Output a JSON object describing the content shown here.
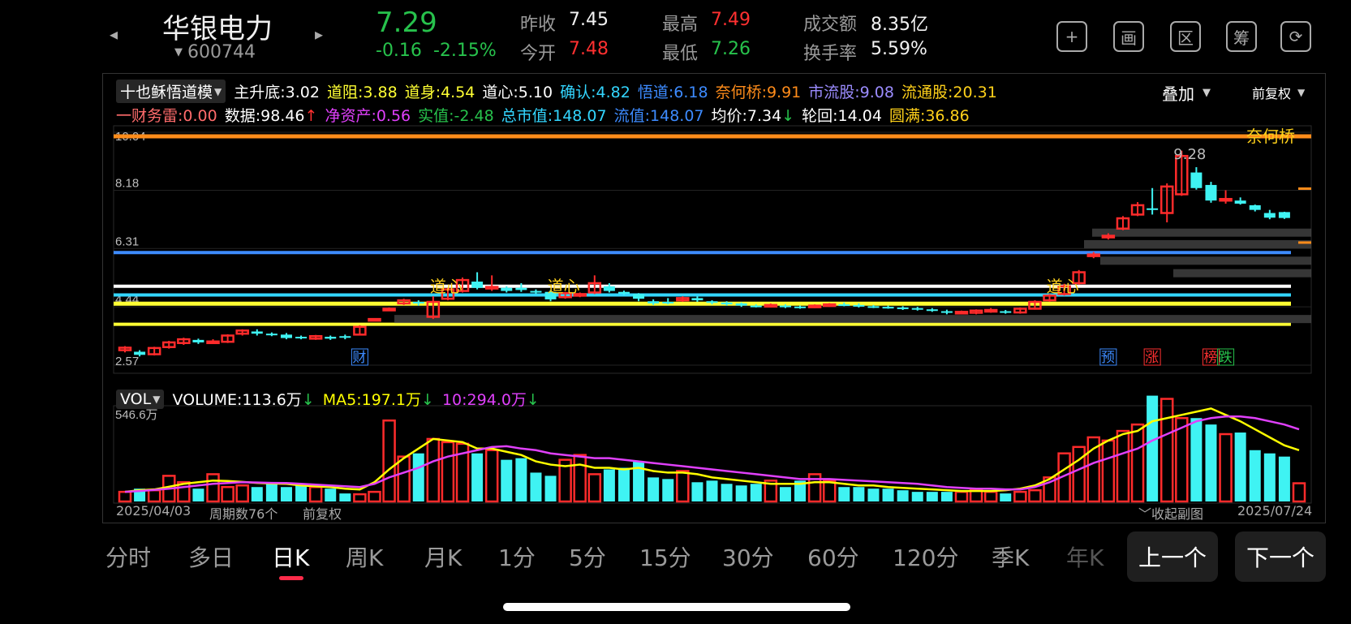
{
  "header": {
    "stock_name": "华银电力",
    "stock_code": "600744",
    "price": "7.29",
    "change": "-0.16",
    "change_pct": "-2.15%",
    "stats": [
      {
        "label": "昨收",
        "value": "7.45",
        "color": "white"
      },
      {
        "label": "今开",
        "value": "7.48",
        "color": "red"
      },
      {
        "label": "最高",
        "value": "7.49",
        "color": "red"
      },
      {
        "label": "最低",
        "value": "7.26",
        "color": "green"
      },
      {
        "label": "成交额",
        "value": "8.35亿",
        "color": "white"
      },
      {
        "label": "换手率",
        "value": "5.59%",
        "color": "white"
      }
    ],
    "icons": [
      "plus-icon",
      "picture-icon",
      "zone-icon",
      "chips-icon",
      "rotate-icon"
    ],
    "icon_glyphs": [
      "+",
      "画",
      "区",
      "筹",
      "⟳"
    ]
  },
  "indicators": {
    "selector": "十也稣悟道模",
    "row1": [
      {
        "text": "主升底:3.02",
        "color": "#ffffff"
      },
      {
        "text": "道阻:3.88",
        "color": "#ffff33"
      },
      {
        "text": "道身:4.54",
        "color": "#ffff33"
      },
      {
        "text": "道心:5.10",
        "color": "#ffffff"
      },
      {
        "text": "确认:4.82",
        "color": "#33d6ff"
      },
      {
        "text": "悟道:6.18",
        "color": "#3d8bff"
      },
      {
        "text": "奈何桥:9.91",
        "color": "#ff8c1a"
      },
      {
        "text": "市流股:9.08",
        "color": "#9b8cff"
      },
      {
        "text": "流通股:20.31",
        "color": "#ffd11a"
      }
    ],
    "row2": [
      {
        "text": "一财务雷:0.00",
        "color": "#ff6b6b"
      },
      {
        "text": "数据:98.46",
        "color": "#ffffff",
        "arrow": "↑",
        "arrow_color": "#ff3030"
      },
      {
        "text": "净资产:0.56",
        "color": "#e040fb"
      },
      {
        "text": "实值:-2.48",
        "color": "#27c24c"
      },
      {
        "text": "总市值:148.07",
        "color": "#33d6ff"
      },
      {
        "text": "流值:148.07",
        "color": "#3d8bff"
      },
      {
        "text": "均价:7.34",
        "color": "#ffffff",
        "arrow": "↓",
        "arrow_color": "#27c24c"
      },
      {
        "text": "轮回:14.04",
        "color": "#ffffff"
      },
      {
        "text": "圆满:36.86",
        "color": "#ffd11a"
      }
    ],
    "overlay_label": "叠加",
    "adjust_label": "前复权"
  },
  "chart_data": [
    {
      "type": "candlestick",
      "y_ticks": [
        "10.04",
        "8.18",
        "6.31",
        "4.44",
        "2.57"
      ],
      "ylim": [
        2.57,
        10.04
      ],
      "candles": [
        [
          3.05,
          3.13,
          2.98,
          3.18
        ],
        [
          3.0,
          2.9,
          2.85,
          3.05
        ],
        [
          2.92,
          3.12,
          2.88,
          3.16
        ],
        [
          3.15,
          3.3,
          3.1,
          3.35
        ],
        [
          3.28,
          3.4,
          3.22,
          3.45
        ],
        [
          3.38,
          3.3,
          3.25,
          3.42
        ],
        [
          3.3,
          3.33,
          3.25,
          3.4
        ],
        [
          3.32,
          3.52,
          3.28,
          3.56
        ],
        [
          3.58,
          3.68,
          3.52,
          3.72
        ],
        [
          3.65,
          3.58,
          3.52,
          3.72
        ],
        [
          3.58,
          3.55,
          3.5,
          3.62
        ],
        [
          3.55,
          3.44,
          3.4,
          3.6
        ],
        [
          3.48,
          3.44,
          3.4,
          3.52
        ],
        [
          3.42,
          3.5,
          3.38,
          3.54
        ],
        [
          3.48,
          3.42,
          3.38,
          3.52
        ],
        [
          3.5,
          3.45,
          3.4,
          3.55
        ],
        [
          3.55,
          3.8,
          3.52,
          3.85
        ],
        [
          4.02,
          4.05,
          3.98,
          4.08
        ],
        [
          4.35,
          4.38,
          4.32,
          4.42
        ],
        [
          4.55,
          4.65,
          4.5,
          4.7
        ],
        [
          4.6,
          4.55,
          4.48,
          4.65
        ],
        [
          4.12,
          4.6,
          4.05,
          4.78
        ],
        [
          4.7,
          5.0,
          4.65,
          5.05
        ],
        [
          4.95,
          5.3,
          4.9,
          5.38
        ],
        [
          5.25,
          5.05,
          5.0,
          5.55
        ],
        [
          5.05,
          5.08,
          4.95,
          5.45
        ],
        [
          5.05,
          4.95,
          4.9,
          5.1
        ],
        [
          5.05,
          4.98,
          4.92,
          5.2
        ],
        [
          4.95,
          4.9,
          4.85,
          5.0
        ],
        [
          4.92,
          4.68,
          4.62,
          4.98
        ],
        [
          4.75,
          4.88,
          4.7,
          4.92
        ],
        [
          4.8,
          4.85,
          4.75,
          4.9
        ],
        [
          4.9,
          5.2,
          4.85,
          5.45
        ],
        [
          5.1,
          4.95,
          4.9,
          5.2
        ],
        [
          4.92,
          4.88,
          4.82,
          4.96
        ],
        [
          4.85,
          4.7,
          4.62,
          4.88
        ],
        [
          4.62,
          4.55,
          4.5,
          4.68
        ],
        [
          4.6,
          4.58,
          4.52,
          4.72
        ],
        [
          4.65,
          4.72,
          4.6,
          4.78
        ],
        [
          4.72,
          4.65,
          4.6,
          4.78
        ],
        [
          4.62,
          4.58,
          4.52,
          4.65
        ],
        [
          4.58,
          4.52,
          4.48,
          4.62
        ],
        [
          4.55,
          4.48,
          4.44,
          4.58
        ],
        [
          4.48,
          4.46,
          4.42,
          4.52
        ],
        [
          4.48,
          4.5,
          4.42,
          4.55
        ],
        [
          4.48,
          4.45,
          4.4,
          4.52
        ],
        [
          4.45,
          4.42,
          4.38,
          4.48
        ],
        [
          4.45,
          4.48,
          4.4,
          4.52
        ],
        [
          4.48,
          4.52,
          4.44,
          4.56
        ],
        [
          4.52,
          4.5,
          4.46,
          4.58
        ],
        [
          4.5,
          4.46,
          4.42,
          4.55
        ],
        [
          4.46,
          4.44,
          4.4,
          4.5
        ],
        [
          4.44,
          4.42,
          4.38,
          4.48
        ],
        [
          4.42,
          4.38,
          4.34,
          4.46
        ],
        [
          4.4,
          4.36,
          4.32,
          4.44
        ],
        [
          4.36,
          4.32,
          4.28,
          4.4
        ],
        [
          4.3,
          4.25,
          4.2,
          4.35
        ],
        [
          4.25,
          4.28,
          4.2,
          4.32
        ],
        [
          4.25,
          4.32,
          4.2,
          4.36
        ],
        [
          4.3,
          4.34,
          4.25,
          4.4
        ],
        [
          4.3,
          4.26,
          4.22,
          4.34
        ],
        [
          4.26,
          4.38,
          4.22,
          4.42
        ],
        [
          4.38,
          4.6,
          4.35,
          4.65
        ],
        [
          4.65,
          4.8,
          4.6,
          4.85
        ],
        [
          4.85,
          5.1,
          4.8,
          5.18
        ],
        [
          5.2,
          5.55,
          5.15,
          5.62
        ],
        [
          6.1,
          6.12,
          6.0,
          6.2
        ],
        [
          6.7,
          6.72,
          6.6,
          6.8
        ],
        [
          6.95,
          7.28,
          6.9,
          7.35
        ],
        [
          7.4,
          7.7,
          7.35,
          7.8
        ],
        [
          7.6,
          7.55,
          7.4,
          8.25
        ],
        [
          7.45,
          8.3,
          7.15,
          8.4
        ],
        [
          8.05,
          9.28,
          8.0,
          9.45
        ],
        [
          8.75,
          8.25,
          8.2,
          8.92
        ],
        [
          8.35,
          7.85,
          7.78,
          8.45
        ],
        [
          7.85,
          7.9,
          7.75,
          8.18
        ],
        [
          7.85,
          7.75,
          7.72,
          7.95
        ],
        [
          7.7,
          7.55,
          7.5,
          7.72
        ],
        [
          7.45,
          7.3,
          7.25,
          7.55
        ],
        [
          7.48,
          7.29,
          7.26,
          7.49
        ]
      ],
      "candle_format": "[open, close, low, high]",
      "levels": [
        {
          "name": "奈何桥",
          "value": 9.91,
          "color": "#ff8c1a"
        },
        {
          "name": "悟道",
          "value": 6.18,
          "color": "#3d8bff"
        },
        {
          "name": "道心",
          "value": 5.1,
          "color": "#ffffff"
        },
        {
          "name": "确认",
          "value": 4.82,
          "color": "#33d6ff"
        },
        {
          "name": "道身",
          "value": 4.54,
          "color": "#ffff33"
        },
        {
          "name": "道阻",
          "value": 3.88,
          "color": "#ffff33"
        }
      ],
      "annotations": [
        {
          "text": "道心",
          "candle": 22
        },
        {
          "text": "道心",
          "candle": 30
        },
        {
          "text": "道心",
          "candle": 64
        },
        {
          "text": "奈何桥",
          "position": "top-right"
        },
        {
          "text": "9.28",
          "candle": 72
        }
      ],
      "event_markers": [
        {
          "text": "财",
          "candle": 16,
          "color": "#3d8bff"
        },
        {
          "text": "预",
          "candle": 67,
          "color": "#3d8bff"
        },
        {
          "text": "涨",
          "candle": 70,
          "color": "#ff3030"
        },
        {
          "text": "榜",
          "candle": 74,
          "color": "#ff3030"
        },
        {
          "text": "跌",
          "candle": 75,
          "color": "#27c24c"
        }
      ]
    },
    {
      "type": "bar",
      "title": "VOLUME",
      "ylim": [
        0,
        546.6
      ],
      "y_unit": "万",
      "y_ticks": [
        "546.6万"
      ],
      "values": [
        60,
        80,
        70,
        160,
        120,
        80,
        170,
        90,
        100,
        90,
        120,
        90,
        100,
        90,
        80,
        50,
        45,
        60,
        505,
        280,
        300,
        390,
        370,
        360,
        300,
        320,
        260,
        270,
        180,
        160,
        260,
        290,
        170,
        200,
        210,
        250,
        150,
        140,
        190,
        120,
        130,
        110,
        100,
        110,
        130,
        90,
        130,
        170,
        130,
        90,
        90,
        80,
        80,
        70,
        60,
        60,
        60,
        60,
        70,
        60,
        50,
        60,
        70,
        150,
        300,
        340,
        400,
        380,
        440,
        480,
        660,
        640,
        520,
        520,
        480,
        420,
        430,
        320,
        300,
        280,
        113.6
      ],
      "bar_colors_up": "#ff2b2b",
      "bar_colors_down": "#3ff3f3",
      "series": [
        {
          "name": "MA5",
          "color": "#ffff00",
          "values": [
            60,
            70,
            75,
            92,
            110,
            120,
            130,
            128,
            122,
            116,
            112,
            110,
            100,
            95,
            90,
            80,
            75,
            120,
            200,
            270,
            330,
            390,
            380,
            370,
            330,
            330,
            310,
            290,
            250,
            230,
            220,
            230,
            210,
            210,
            200,
            210,
            190,
            180,
            180,
            170,
            150,
            140,
            130,
            120,
            110,
            110,
            110,
            120,
            120,
            110,
            100,
            100,
            90,
            85,
            80,
            75,
            70,
            65,
            65,
            65,
            70,
            80,
            100,
            140,
            200,
            260,
            330,
            380,
            420,
            440,
            500,
            520,
            540,
            560,
            580,
            540,
            500,
            450,
            400,
            350,
            320
          ]
        },
        {
          "name": "10",
          "color": "#e040fb",
          "values": [
            60,
            65,
            72,
            80,
            90,
            100,
            110,
            115,
            120,
            118,
            116,
            115,
            110,
            105,
            100,
            95,
            90,
            110,
            150,
            180,
            210,
            250,
            280,
            300,
            320,
            340,
            345,
            330,
            320,
            300,
            290,
            280,
            270,
            270,
            260,
            250,
            240,
            230,
            220,
            210,
            200,
            190,
            180,
            170,
            160,
            150,
            140,
            140,
            140,
            135,
            130,
            125,
            120,
            115,
            110,
            100,
            90,
            85,
            80,
            80,
            75,
            75,
            90,
            120,
            160,
            200,
            240,
            270,
            300,
            330,
            380,
            420,
            460,
            500,
            520,
            530,
            530,
            520,
            500,
            480,
            450
          ]
        }
      ],
      "legend": [
        {
          "text": "VOLUME:113.6万",
          "arrow": "↓",
          "color": "#ffffff"
        },
        {
          "text": "MA5:197.1万",
          "arrow": "↓",
          "color": "#ffff00"
        },
        {
          "text": "10:294.0万",
          "arrow": "↓",
          "color": "#e040fb"
        }
      ]
    }
  ],
  "volume_selector": "VOL",
  "bottom_bar": {
    "start_date": "2025/04/03",
    "period_count": "周期数76个",
    "adjust": "前复权",
    "collapse": "收起副图",
    "end_date": "2025/07/24"
  },
  "tabs": [
    "分时",
    "多日",
    "日K",
    "周K",
    "月K",
    "1分",
    "5分",
    "15分",
    "30分",
    "60分",
    "120分",
    "季K",
    "年K"
  ],
  "active_tab": "日K",
  "nav_buttons": {
    "prev": "上一个",
    "next": "下一个"
  }
}
